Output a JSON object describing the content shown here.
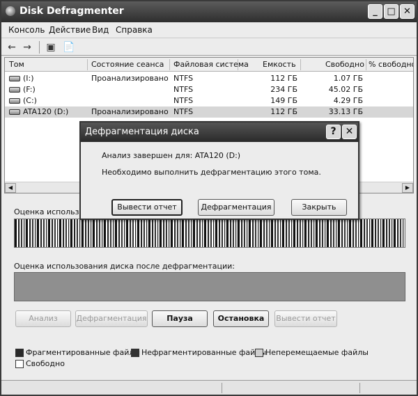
{
  "window": {
    "title": "Disk Defragmenter",
    "icon": "defrag-app-icon"
  },
  "title_buttons": {
    "minimize": "_",
    "maximize": "□",
    "close": "✕"
  },
  "menu": [
    {
      "label": "Консоль"
    },
    {
      "label": "Действие"
    },
    {
      "label": "Вид"
    },
    {
      "label": "Справка"
    }
  ],
  "toolbar": {
    "back": "←",
    "forward": "→",
    "console_tree": "▣",
    "properties": "📄"
  },
  "volume_list": {
    "columns": [
      "Том",
      "Состояние сеанса",
      "Файловая система",
      "Емкость",
      "Свободно",
      "% свободного"
    ],
    "rows": [
      {
        "volume": "(I:)",
        "status": "Проанализировано",
        "fs": "NTFS",
        "capacity": "112 ГБ",
        "free": "1.07 ГБ",
        "selected": false
      },
      {
        "volume": "(F:)",
        "status": "",
        "fs": "NTFS",
        "capacity": "234 ГБ",
        "free": "45.02 ГБ",
        "selected": false
      },
      {
        "volume": "(C:)",
        "status": "",
        "fs": "NTFS",
        "capacity": "149 ГБ",
        "free": "4.29 ГБ",
        "selected": false
      },
      {
        "volume": "ATA120 (D:)",
        "status": "Проанализировано",
        "fs": "NTFS",
        "capacity": "112 ГБ",
        "free": "33.13 ГБ",
        "selected": true
      }
    ]
  },
  "usage": {
    "before_label": "Оценка использо",
    "after_label": "Оценка использования диска после дефрагментации:"
  },
  "actions": {
    "analyze": "Анализ",
    "defragment": "Дефрагментация",
    "pause": "Пауза",
    "stop": "Остановка",
    "report": "Вывести отчет"
  },
  "legend": {
    "fragmented": "Фрагментированные файлы",
    "contiguous": "Нефрагментированные файлы",
    "unmovable": "Неперемещаемые файлы",
    "free": "Свободно",
    "colors": {
      "fragmented": "#2a2a2a",
      "contiguous": "#333333",
      "unmovable": "#cfcfcf",
      "free": "#ffffff"
    }
  },
  "dialog": {
    "title": "Дефрагментация диска",
    "help": "?",
    "close": "✕",
    "message1": "Анализ завершен для: ATA120 (D:)",
    "message2": "Необходимо выполнить дефрагментацию этого тома.",
    "buttons": {
      "report": "Вывести отчет",
      "defragment": "Дефрагментация",
      "close": "Закрыть"
    }
  }
}
